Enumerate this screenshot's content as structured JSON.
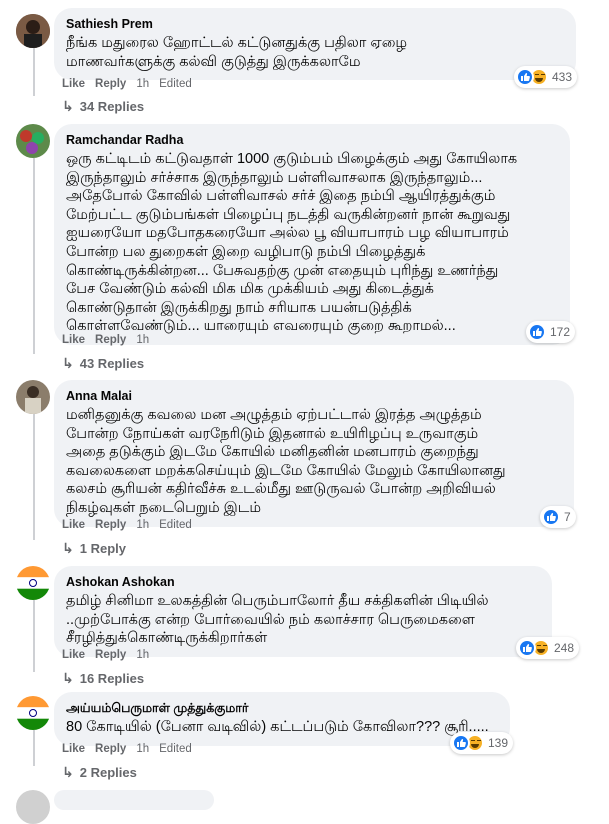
{
  "comments": [
    {
      "author": "Sathiesh Prem",
      "lines": [
        "நீங்க மதுரைல ஹோட்டல் கட்டுனதுக்கு பதிலா ஏழை",
        "மாணவர்களுக்கு கல்வி குடுத்து இருக்கலாமே"
      ],
      "like_label": "Like",
      "reply_label": "Reply",
      "time": "1h",
      "edited": "Edited",
      "reactions": [
        "like",
        "haha"
      ],
      "reaction_count": "433",
      "replies_label": "34 Replies"
    },
    {
      "author": "Ramchandar Radha",
      "lines": [
        "ஒரு கட்டிடம் கட்டுவதாள் 1000 குடும்பம் பிழைக்கும் அது கோயிலாக",
        "இருந்தாலும் சர்ச்சாக இருந்தாலும் பள்ளிவாசலாக இருந்தாலும்...",
        "அதேபோல் கோவில் பள்ளிவாசல் சர்ச் இதை நம்பி ஆயிரத்துக்கும்",
        "மேற்பட்ட குடும்பங்கள் பிழைப்பு நடத்தி வருகின்றனர் நான் கூறுவது",
        "ஐயரையோ மதபோதகரையோ அல்ல பூ வியாபாரம் பழ வியாபாரம்",
        "போன்ற பல துறைகள் இறை வழிபாடு நம்பி பிழைத்துக்",
        "கொண்டிருக்கின்றன... பேசுவதற்கு முன் எதையும் புரிந்து உணர்ந்து",
        "பேச வேண்டும் கல்வி மிக மிக முக்கியம் அது கிடைத்துக்",
        "கொண்டுதான் இருக்கிறது நாம் சரியாக பயன்படுத்திக்",
        "கொள்ளவேண்டும்... யாரையும் எவரையும் குறை கூறாமல்..."
      ],
      "like_label": "Like",
      "reply_label": "Reply",
      "time": "1h",
      "edited": "",
      "reactions": [
        "like"
      ],
      "reaction_count": "172",
      "replies_label": "43 Replies"
    },
    {
      "author": "Anna Malai",
      "lines": [
        "மனிதனுக்கு கவலை மன அழுத்தம் ஏற்பட்டால் இரத்த அழுத்தம்",
        "போன்ற நோய்கள் வரநேரிடும் இதனால் உயிரிழப்பு உருவாகும்",
        "அதை தடுக்கும் இடமே கோயில் மனிதனின் மனபாரம் குறைந்து",
        "கவலைகளை மறக்கசெய்யும் இடமே கோயில் மேலும் கோயிலானது",
        "கலசம் சூரியன் கதிர்வீச்சு உடல்மீது ஊடுருவல் போன்ற அறிவியல்",
        "நிகழ்வுகள் நடைபெறும் இடம்"
      ],
      "like_label": "Like",
      "reply_label": "Reply",
      "time": "1h",
      "edited": "Edited",
      "reactions": [
        "like"
      ],
      "reaction_count": "7",
      "replies_label": "1 Reply"
    },
    {
      "author": "Ashokan Ashokan",
      "lines": [
        "தமிழ் சினிமா உலகத்தின் பெரும்பாலோர் தீய சக்திகளின் பிடியில்",
        "..முற்போக்கு என்ற போர்வையில் நம் கலாச்சார பெருமைகளை",
        "சீரழித்துக்கொண்டிருக்கிறார்கள்"
      ],
      "like_label": "Like",
      "reply_label": "Reply",
      "time": "1h",
      "edited": "",
      "reactions": [
        "like",
        "haha"
      ],
      "reaction_count": "248",
      "replies_label": "16 Replies"
    },
    {
      "author": "அய்யம்பெருமாள் முத்துக்குமார்",
      "lines": [
        "80 கோடியில் (பேனா வடிவில்) கட்டப்படும் கோவிலா??? சூரி....."
      ],
      "like_label": "Like",
      "reply_label": "Reply",
      "time": "1h",
      "edited": "Edited",
      "reactions": [
        "like",
        "haha"
      ],
      "reaction_count": "139",
      "replies_label": "2 Replies"
    }
  ],
  "colors": {
    "bubble": "#f0f2f5",
    "like": "#1877f2",
    "haha": "#f7b125",
    "muted": "#65676b"
  }
}
